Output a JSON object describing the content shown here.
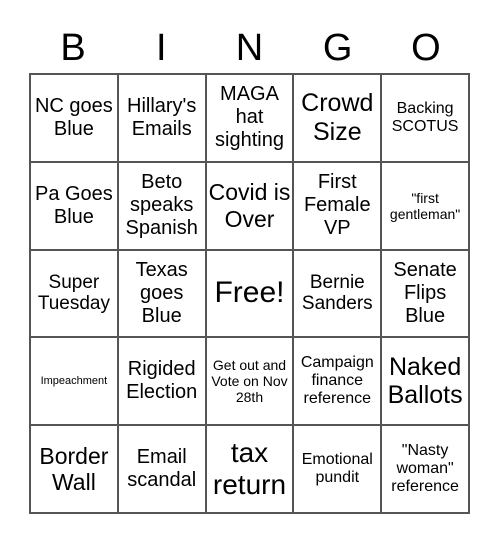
{
  "header": {
    "letters": [
      "B",
      "I",
      "N",
      "G",
      "O"
    ]
  },
  "cells": [
    [
      "NC goes Blue",
      "Hillary's Emails",
      "MAGA hat sighting",
      "Crowd Size",
      "Backing SCOTUS"
    ],
    [
      "Pa Goes Blue",
      "Beto speaks Spanish",
      "Covid is Over",
      "First Female VP",
      "\"first gentleman\""
    ],
    [
      "Super Tuesday",
      "Texas goes Blue",
      "Free!",
      "Bernie Sanders",
      "Senate Flips Blue"
    ],
    [
      "Impeachment",
      "Rigided Election",
      "Get out and Vote on Nov 28th",
      "Campaign finance reference",
      "Naked Ballots"
    ],
    [
      "Border Wall",
      "Email scandal",
      "tax return",
      "Emotional pundit",
      "\"Nasty woman\" reference"
    ]
  ]
}
